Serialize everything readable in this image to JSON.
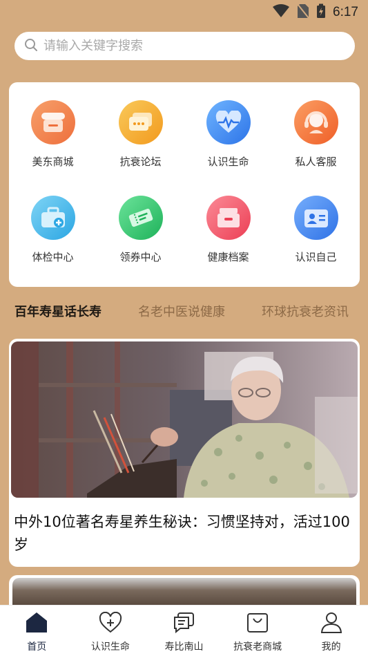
{
  "status": {
    "time": "6:17"
  },
  "search": {
    "placeholder": "请输入关键字搜索"
  },
  "grid": [
    {
      "label": "美东商城",
      "icon": "shop-icon",
      "color": "#f2844f"
    },
    {
      "label": "抗衰论坛",
      "icon": "chat-icon",
      "color": "#f5ad2a"
    },
    {
      "label": "认识生命",
      "icon": "heartbeat-icon",
      "color": "#3d8ef0"
    },
    {
      "label": "私人客服",
      "icon": "headset-icon",
      "color": "#f57a3a"
    },
    {
      "label": "体检中心",
      "icon": "medical-kit-icon",
      "color": "#3fb6ea"
    },
    {
      "label": "领券中心",
      "icon": "coupon-icon",
      "color": "#2fc26a"
    },
    {
      "label": "健康档案",
      "icon": "archive-icon",
      "color": "#f25b6a"
    },
    {
      "label": "认识自己",
      "icon": "id-card-icon",
      "color": "#3f86ef"
    }
  ],
  "tabs": [
    {
      "label": "百年寿星话长寿",
      "active": true
    },
    {
      "label": "名老中医说健康",
      "active": false
    },
    {
      "label": "环球抗衰老资讯",
      "active": false
    }
  ],
  "articles": [
    {
      "title": "中外10位著名寿星养生秘诀：习惯坚持对，活过100岁"
    }
  ],
  "nav": [
    {
      "label": "首页",
      "icon": "home-icon",
      "active": true
    },
    {
      "label": "认识生命",
      "icon": "heart-plus-icon",
      "active": false
    },
    {
      "label": "寿比南山",
      "icon": "message-icon",
      "active": false
    },
    {
      "label": "抗衰老商城",
      "icon": "bag-icon",
      "active": false
    },
    {
      "label": "我的",
      "icon": "user-icon",
      "active": false
    }
  ]
}
